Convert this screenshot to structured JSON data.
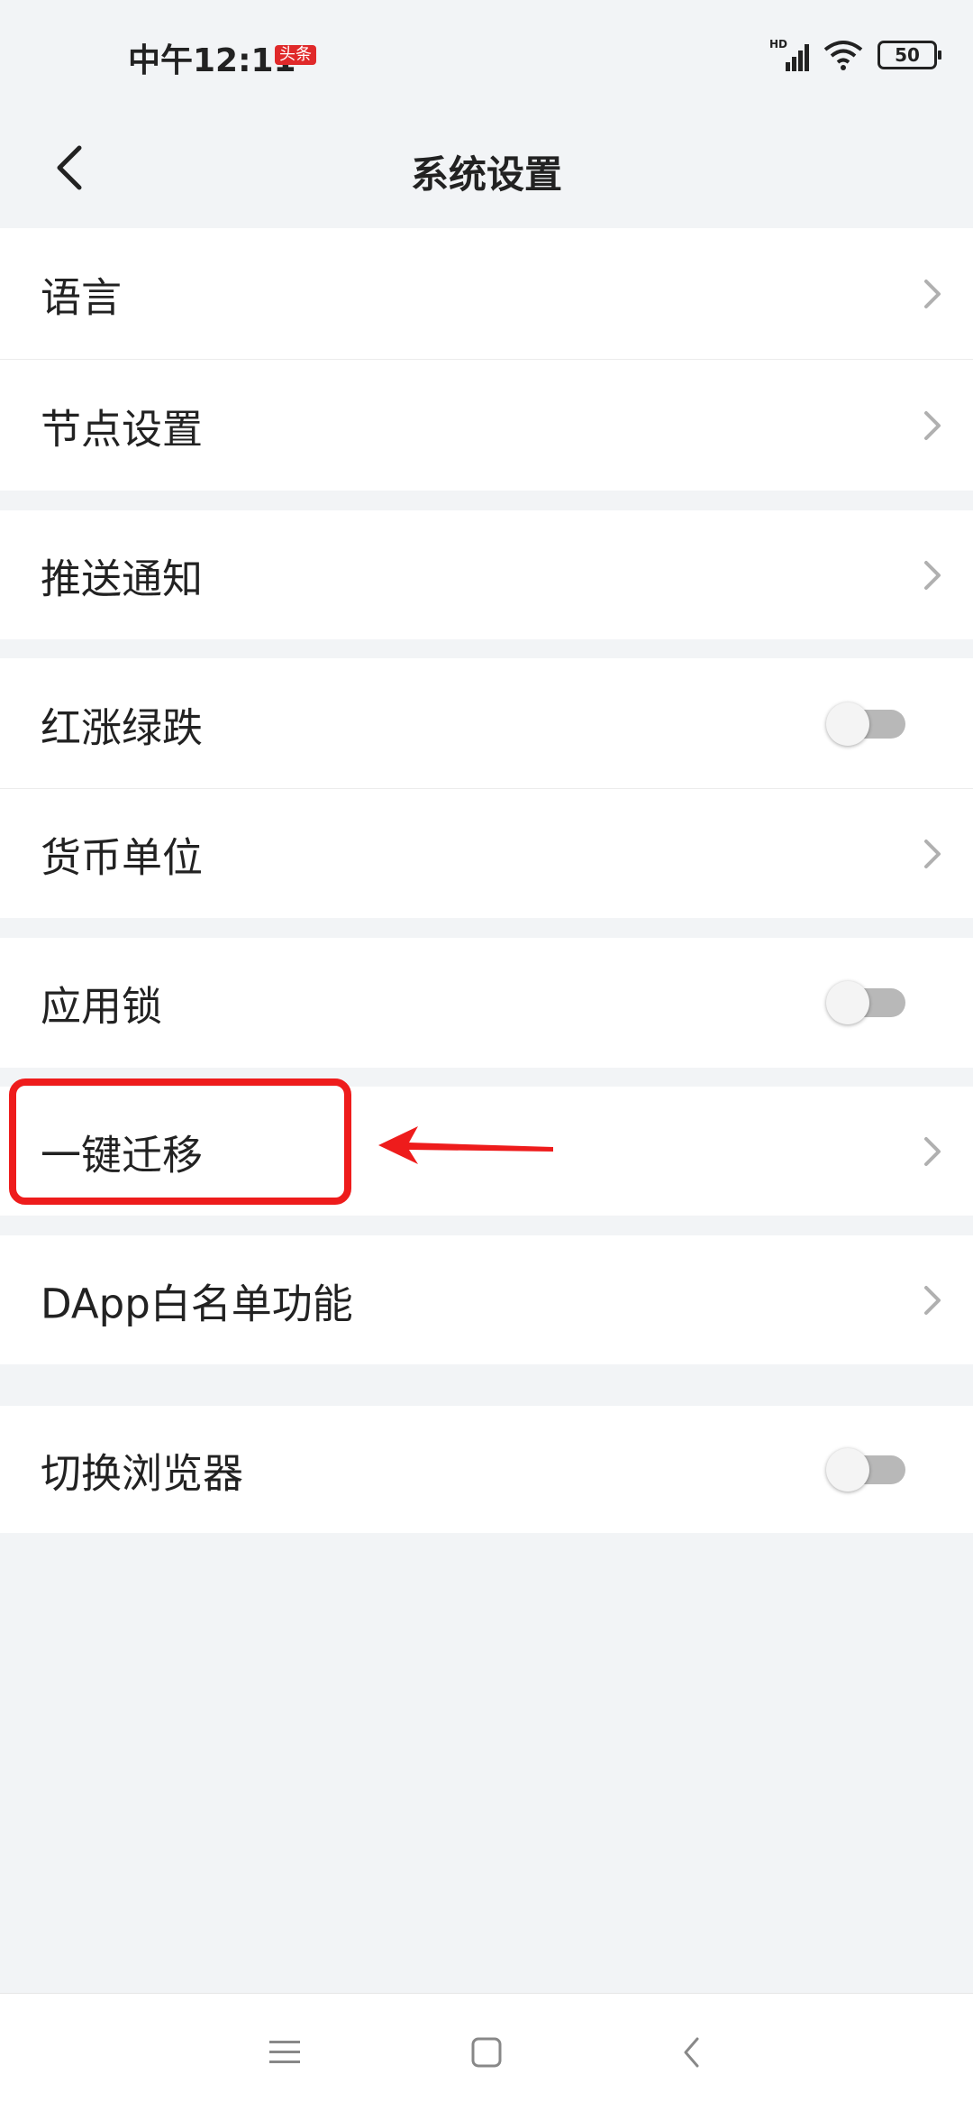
{
  "status_bar": {
    "time": "中午12:11",
    "badge": "头条",
    "battery": "50",
    "network_label": "HD",
    "icons": [
      "signal-icon",
      "wifi-icon",
      "battery-icon"
    ]
  },
  "header": {
    "title": "系统设置",
    "back_icon": "chevron-left-icon"
  },
  "settings": [
    {
      "label": "语言",
      "control": "chevron"
    },
    {
      "label": "节点设置",
      "control": "chevron"
    },
    {
      "label": "推送通知",
      "control": "chevron"
    },
    {
      "label": "红涨绿跌",
      "control": "toggle",
      "on": false
    },
    {
      "label": "货币单位",
      "control": "chevron"
    },
    {
      "label": "应用锁",
      "control": "toggle",
      "on": false
    },
    {
      "label": "一键迁移",
      "control": "chevron"
    },
    {
      "label": "DApp白名单功能",
      "control": "chevron"
    },
    {
      "label": "切换浏览器",
      "control": "toggle",
      "on": false
    }
  ],
  "annotation": {
    "highlight_color": "#ee1c1c",
    "arrow_icon": "red-arrow-icon"
  },
  "nav_bar": {
    "icons": [
      "menu-icon",
      "home-icon",
      "back-icon"
    ]
  }
}
